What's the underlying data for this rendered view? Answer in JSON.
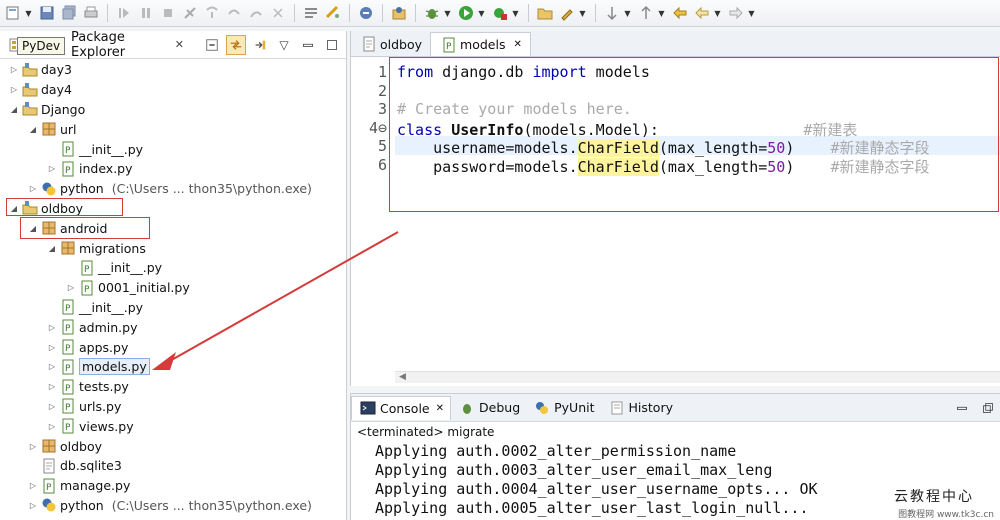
{
  "explorer": {
    "tooltip": "PyDev",
    "title": "Package Explorer",
    "close": "✕"
  },
  "tree": [
    {
      "indent": 0,
      "twisty": "▷",
      "icon": "project",
      "label": "day3",
      "suffix": ""
    },
    {
      "indent": 0,
      "twisty": "▷",
      "icon": "project",
      "label": "day4",
      "suffix": ""
    },
    {
      "indent": 0,
      "twisty": "◢",
      "icon": "project",
      "label": "Django",
      "suffix": ""
    },
    {
      "indent": 1,
      "twisty": "◢",
      "icon": "package",
      "label": "url",
      "suffix": ""
    },
    {
      "indent": 2,
      "twisty": "",
      "icon": "pyfile",
      "label": "__init__.py",
      "suffix": ""
    },
    {
      "indent": 2,
      "twisty": "▷",
      "icon": "pyfile",
      "label": "index.py",
      "suffix": ""
    },
    {
      "indent": 1,
      "twisty": "▷",
      "icon": "python",
      "label": "python",
      "suffix": "(C:\\Users ... thon35\\python.exe)"
    },
    {
      "indent": 0,
      "twisty": "◢",
      "icon": "project",
      "label": "oldboy",
      "suffix": ""
    },
    {
      "indent": 1,
      "twisty": "◢",
      "icon": "package",
      "label": "android",
      "suffix": ""
    },
    {
      "indent": 2,
      "twisty": "◢",
      "icon": "package",
      "label": "migrations",
      "suffix": ""
    },
    {
      "indent": 3,
      "twisty": "",
      "icon": "pyfile",
      "label": "__init__.py",
      "suffix": ""
    },
    {
      "indent": 3,
      "twisty": "▷",
      "icon": "pyfile",
      "label": "0001_initial.py",
      "suffix": ""
    },
    {
      "indent": 2,
      "twisty": "",
      "icon": "pyfile",
      "label": "__init__.py",
      "suffix": ""
    },
    {
      "indent": 2,
      "twisty": "▷",
      "icon": "pyfile",
      "label": "admin.py",
      "suffix": ""
    },
    {
      "indent": 2,
      "twisty": "▷",
      "icon": "pyfile",
      "label": "apps.py",
      "suffix": ""
    },
    {
      "indent": 2,
      "twisty": "▷",
      "icon": "pyfile",
      "label": "models.py",
      "suffix": ""
    },
    {
      "indent": 2,
      "twisty": "▷",
      "icon": "pyfile",
      "label": "tests.py",
      "suffix": ""
    },
    {
      "indent": 2,
      "twisty": "▷",
      "icon": "pyfile",
      "label": "urls.py",
      "suffix": ""
    },
    {
      "indent": 2,
      "twisty": "▷",
      "icon": "pyfile",
      "label": "views.py",
      "suffix": ""
    },
    {
      "indent": 1,
      "twisty": "▷",
      "icon": "package",
      "label": "oldboy",
      "suffix": ""
    },
    {
      "indent": 1,
      "twisty": "",
      "icon": "file",
      "label": "db.sqlite3",
      "suffix": ""
    },
    {
      "indent": 1,
      "twisty": "▷",
      "icon": "pyfile",
      "label": "manage.py",
      "suffix": ""
    },
    {
      "indent": 1,
      "twisty": "▷",
      "icon": "python",
      "label": "python",
      "suffix": "(C:\\Users ... thon35\\python.exe)"
    }
  ],
  "editor": {
    "tabs": [
      {
        "label": "oldboy",
        "active": false
      },
      {
        "label": "models",
        "active": true,
        "close": "✕"
      }
    ],
    "lines": [
      {
        "n": "1",
        "parts": [
          {
            "t": "from",
            "c": "kw"
          },
          {
            "t": " django.db ",
            "c": ""
          },
          {
            "t": "import",
            "c": "kw"
          },
          {
            "t": " models",
            "c": ""
          }
        ]
      },
      {
        "n": "2",
        "parts": []
      },
      {
        "n": "3",
        "parts": [
          {
            "t": "# Create your models here.",
            "c": "cm"
          }
        ]
      },
      {
        "n": "4⊖",
        "parts": [
          {
            "t": "class",
            "c": "kw"
          },
          {
            "t": " ",
            "c": ""
          },
          {
            "t": "UserInfo",
            "c": "cls"
          },
          {
            "t": "(models.Model):                #新建表",
            "c": "mix1"
          }
        ]
      },
      {
        "n": "5",
        "parts": [
          {
            "t": "    username=models.",
            "c": ""
          },
          {
            "t": "CharField",
            "c": "yel"
          },
          {
            "t": "(max_length=",
            "c": ""
          },
          {
            "t": "50",
            "c": "num"
          },
          {
            "t": ")    #新建静态字段",
            "c": "mix2"
          }
        ]
      },
      {
        "n": "6",
        "parts": [
          {
            "t": "    password=models.",
            "c": ""
          },
          {
            "t": "CharField",
            "c": "yel"
          },
          {
            "t": "(max_length=",
            "c": ""
          },
          {
            "t": "50",
            "c": "num"
          },
          {
            "t": ")    #新建静态字段",
            "c": "mix2"
          }
        ]
      }
    ]
  },
  "console": {
    "tabs": [
      {
        "label": "Console",
        "icon": "console",
        "active": true,
        "close": "✕"
      },
      {
        "label": "Debug",
        "icon": "debug",
        "active": false
      },
      {
        "label": "PyUnit",
        "icon": "pyunit",
        "active": false
      },
      {
        "label": "History",
        "icon": "history",
        "active": false
      }
    ],
    "status": "<terminated> migrate",
    "lines": [
      "Applying auth.0002_alter_permission_name",
      "Applying auth.0003_alter_user_email_max_leng",
      "Applying auth.0004_alter_user_username_opts... OK",
      "Applying auth.0005_alter_user_last_login_null..."
    ],
    "watermark": "云教程中心",
    "watermark2": "图教程网 www.tk3c.cn"
  },
  "colors": {
    "annotation": "#d63a3a",
    "keyword": "#0000b5",
    "comment": "#aaaaaa",
    "highlight": "#fff49e"
  }
}
